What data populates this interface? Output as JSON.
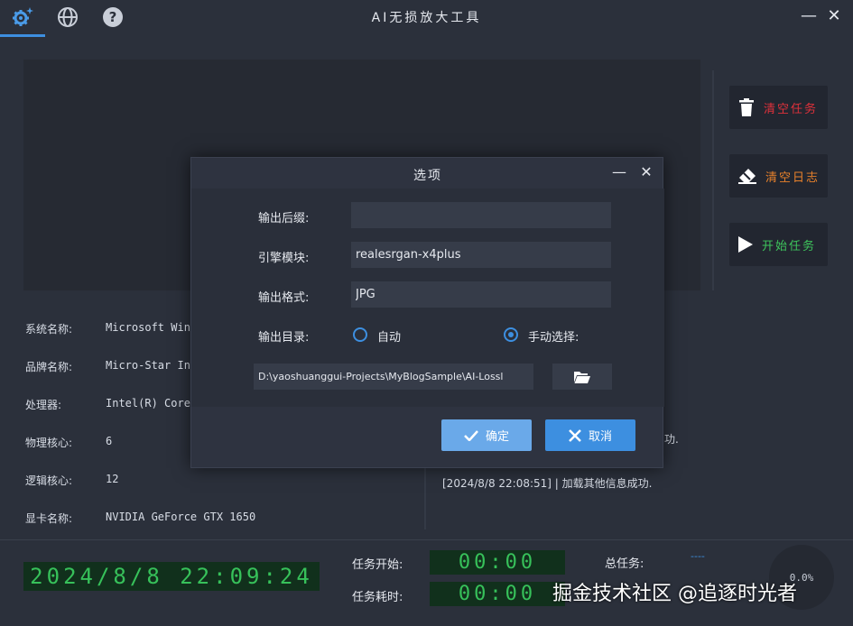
{
  "app": {
    "title": "AI无损放大工具"
  },
  "window_controls": {
    "minimize": "—",
    "close": "✕"
  },
  "titlebar_icons": [
    "gear-sparkle-icon",
    "globe-icon",
    "help-icon"
  ],
  "side_buttons": [
    {
      "label": "清空任务",
      "icon": "trash-icon",
      "color": "#e0313b"
    },
    {
      "label": "清空日志",
      "icon": "eraser-icon",
      "color": "#e8812b"
    },
    {
      "label": "开始任务",
      "icon": "play-icon",
      "color": "#3ec45c"
    }
  ],
  "system_info": [
    {
      "label": "系统名称:",
      "value": "Microsoft Wind"
    },
    {
      "label": "品牌名称:",
      "value": "Micro-Star Int"
    },
    {
      "label": "处理器:",
      "value": "Intel(R) Core(T"
    },
    {
      "label": "物理核心:",
      "value": "6"
    },
    {
      "label": "逻辑核心:",
      "value": "12"
    },
    {
      "label": "显卡名称:",
      "value": "NVIDIA GeForce GTX 1650"
    }
  ],
  "log": {
    "partial_line": "功.",
    "lines": [
      "[2024/8/8 22:08:51] | 加载其他信息成功."
    ]
  },
  "bottom": {
    "clock": "2024/8/8 22:09:24",
    "task_start_label": "任务开始:",
    "task_start_value": "00:00",
    "task_elapsed_label": "任务耗时:",
    "task_elapsed_value": "00:00",
    "total_tasks_label": "总任务:",
    "total_tasks_value": "----",
    "progress": "0.0%"
  },
  "watermark": "掘金技术社区 @追逐时光者",
  "dialog": {
    "title": "选项",
    "minimize": "—",
    "close": "✕",
    "fields": {
      "suffix_label": "输出后缀:",
      "suffix_value": "",
      "engine_label": "引擎模块:",
      "engine_value": "realesrgan-x4plus",
      "format_label": "输出格式:",
      "format_value": "JPG",
      "outdir_label": "输出目录:",
      "radio_auto": "自动",
      "radio_manual": "手动选择:",
      "path_value": "D:\\yaoshuanggui-Projects\\MyBlogSample\\AI-Lossl"
    },
    "ok_label": "确定",
    "cancel_label": "取消",
    "colors": {
      "ok": "#6aa9e9",
      "cancel": "#3d8fe0"
    }
  }
}
